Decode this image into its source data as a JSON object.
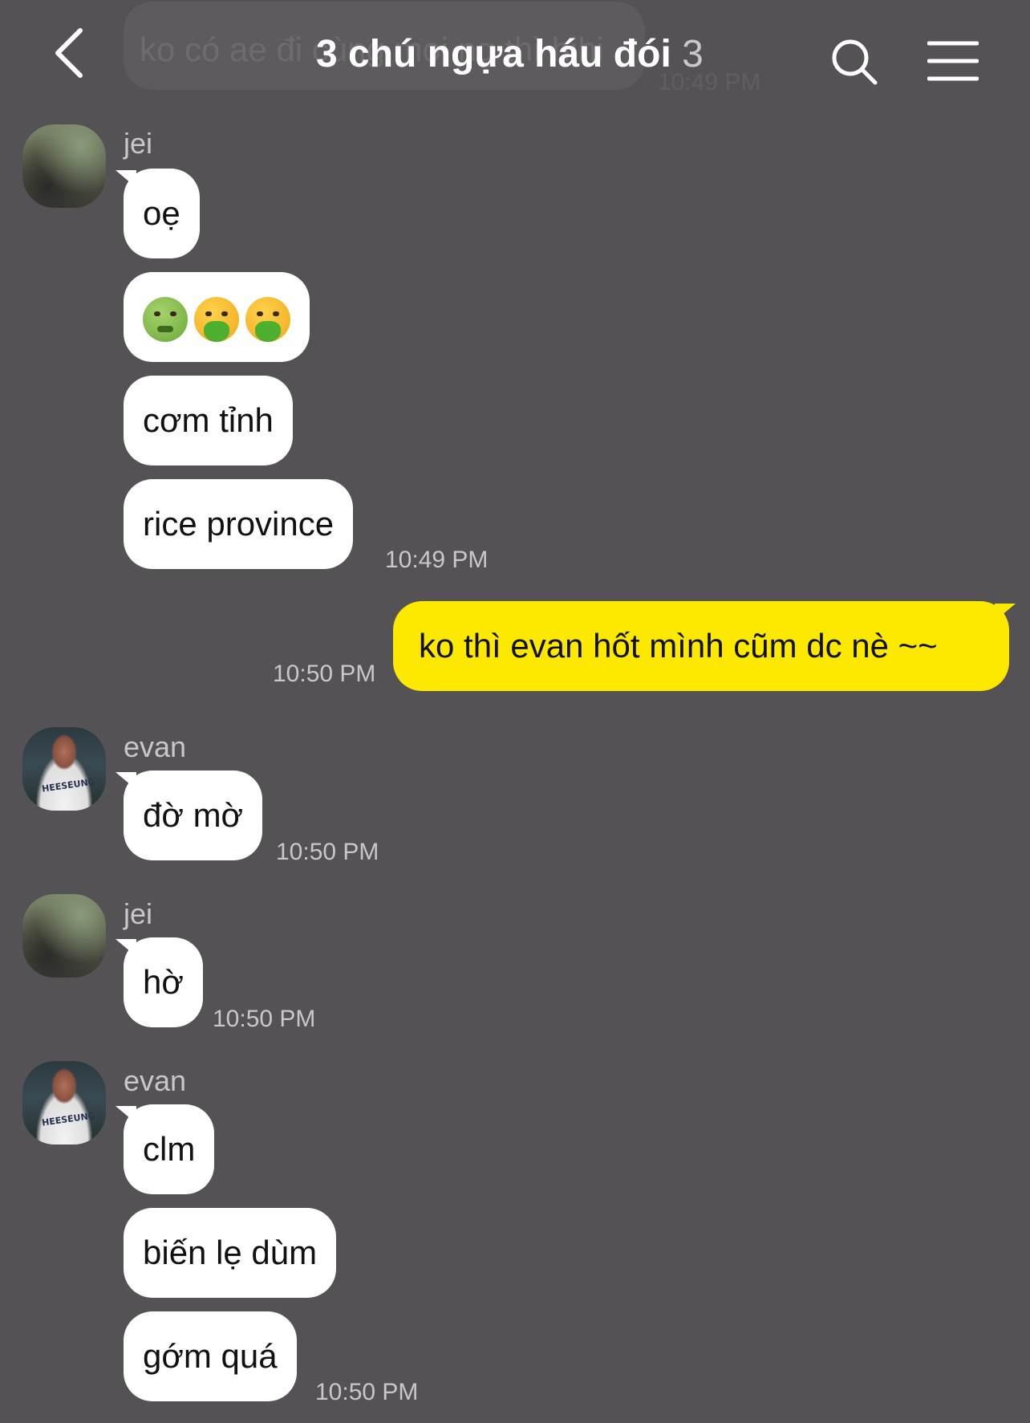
{
  "header": {
    "title": "3 chú ngựa háu đói",
    "member_count": "3",
    "ghost_preview": "ko có ae đi cùng mọi ng thì hihi",
    "ghost_time": "10:49 PM"
  },
  "icons": {
    "back": "chevron-left-icon",
    "search": "search-icon",
    "menu": "hamburger-menu-icon"
  },
  "colors": {
    "background": "#545254",
    "my_bubble": "#fde800",
    "their_bubble": "#ffffff"
  },
  "messages": {
    "m1": {
      "sender": "jei",
      "text": "oẹ"
    },
    "m2": {
      "text": "🤢🤮🤮"
    },
    "m3": {
      "text": "cơm tỉnh"
    },
    "m4": {
      "text": "rice province",
      "time": "10:49 PM"
    },
    "m5": {
      "text": "ko thì evan hốt mình cũm dc nè ~~",
      "time": "10:50 PM"
    },
    "m6": {
      "sender": "evan",
      "text": "đờ mờ",
      "time": "10:50 PM"
    },
    "m7": {
      "sender": "jei",
      "text": "hờ",
      "time": "10:50 PM"
    },
    "m8": {
      "sender": "evan",
      "text": "clm"
    },
    "m9": {
      "text": "biến lẹ dùm"
    },
    "m10": {
      "text": "gớm quá",
      "time": "10:50 PM"
    }
  },
  "avatar_jersey_text": "HEESEUNG"
}
